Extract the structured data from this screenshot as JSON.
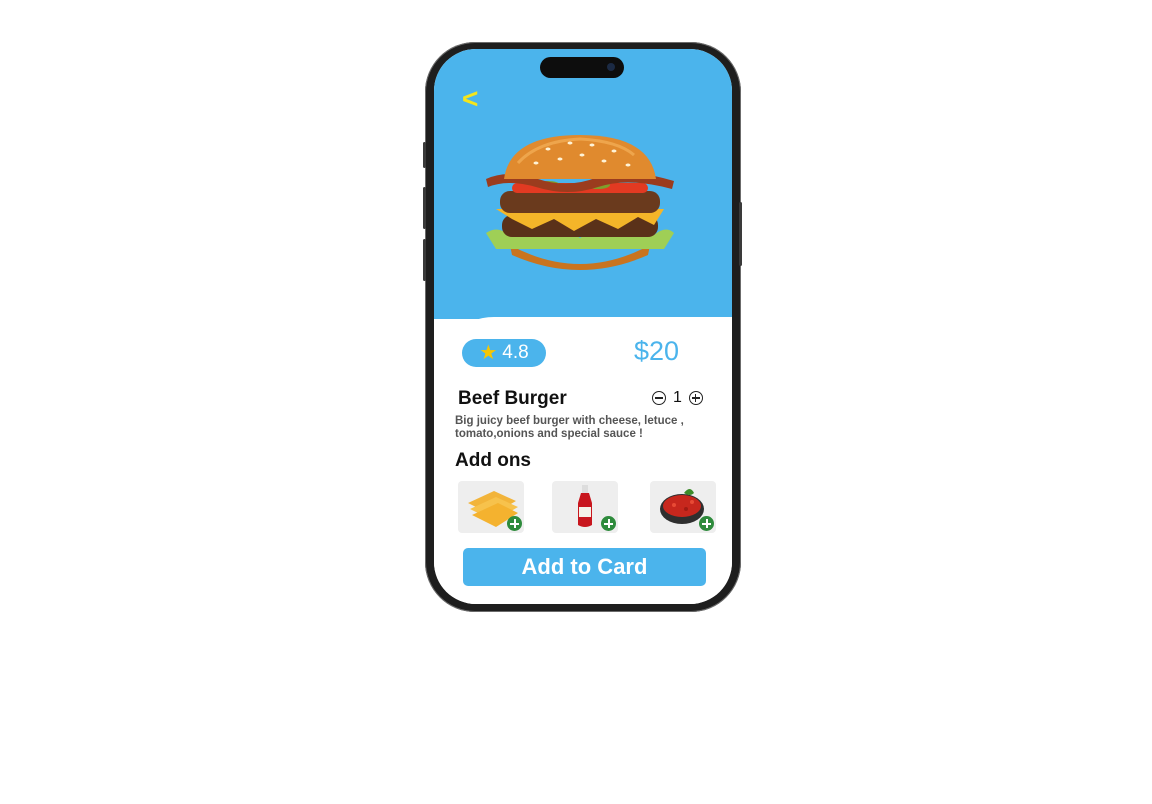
{
  "nav": {
    "back_label": "<"
  },
  "product": {
    "rating": "4.8",
    "price": "$20",
    "name": "Beef Burger",
    "quantity": "1",
    "description": "Big juicy beef burger with cheese, letuce , tomato,onions and special sauce !"
  },
  "addons": {
    "title": "Add ons",
    "items": [
      {
        "name": "cheese"
      },
      {
        "name": "ketchup"
      },
      {
        "name": "tomato-salsa"
      }
    ]
  },
  "cta": {
    "label": "Add to Card"
  },
  "colors": {
    "accent": "#4bb4ec",
    "star": "#f7c600",
    "back": "#f5e51b",
    "add": "#2e8b3c"
  }
}
